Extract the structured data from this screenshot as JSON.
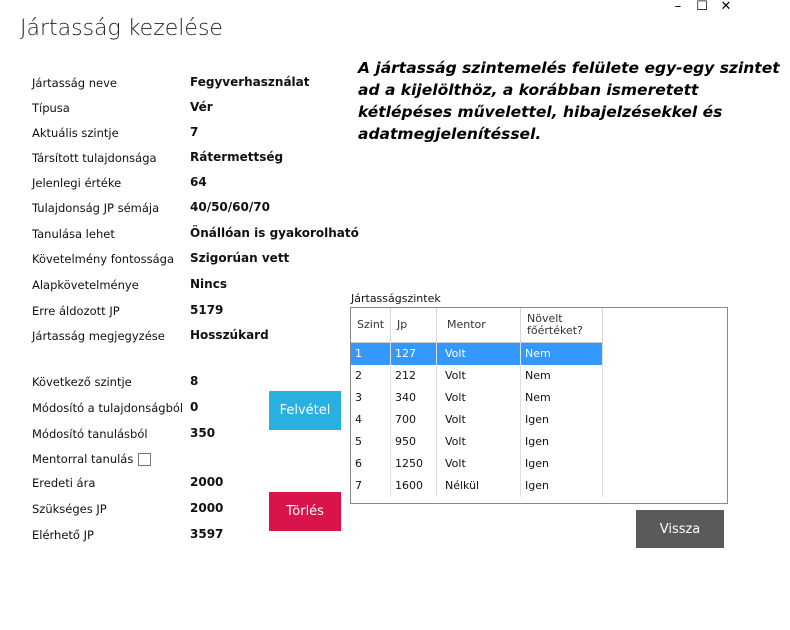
{
  "window": {
    "title": "Jártasság kezelése",
    "controls": {
      "minimize": "–",
      "maximize": "☐",
      "close": "✕"
    }
  },
  "description": "A jártasság szintemelés felülete egy-egy szintet ad a kijelölthöz, a korábban ismeretett kétlépéses művelettel, hibajelzésekkel és adatmegjelenítéssel.",
  "details": [
    {
      "label": "Jártasság neve",
      "value": "Fegyverhasználat"
    },
    {
      "label": "Típusa",
      "value": "Vér"
    },
    {
      "label": "Aktuális szintje",
      "value": "7"
    },
    {
      "label": "Társított tulajdonsága",
      "value": "Rátermettség"
    },
    {
      "label": "Jelenlegi értéke",
      "value": "64"
    },
    {
      "label": "Tulajdonság JP sémája",
      "value": "40/50/60/70"
    },
    {
      "label": "Tanulása lehet",
      "value": "Önállóan is gyakorolható"
    },
    {
      "label": "Követelmény fontossága",
      "value": "Szigorúan vett"
    },
    {
      "label": "Alapkövetelménye",
      "value": "Nincs"
    },
    {
      "label": "Erre áldozott JP",
      "value": "5179"
    },
    {
      "label": "Jártasság megjegyzése",
      "value": "Hosszúkard"
    }
  ],
  "next_level": {
    "next_level": {
      "label": "Következő szintje",
      "value": "8"
    },
    "attr_mod": {
      "label": "Módosító a tulajdonságból",
      "value": "0"
    },
    "learn_mod": {
      "label": "Módosító tanulásból",
      "value": "350"
    },
    "mentor": {
      "label": "Mentorral tanulás",
      "checked": false
    },
    "orig_price": {
      "label": "Eredeti ára",
      "value": "2000"
    },
    "required_jp": {
      "label": "Szükséges JP",
      "value": "2000"
    },
    "available_jp": {
      "label": "Elérhető JP",
      "value": "3597"
    }
  },
  "buttons": {
    "add": "Felvétel",
    "delete": "Törlés",
    "back": "Vissza"
  },
  "colors": {
    "add_button": "#28b0e0",
    "delete_button": "#d8144a",
    "back_button": "#5a5a5a",
    "selected_row": "#3399ff"
  },
  "levels_grid": {
    "caption": "Jártasságszintek",
    "columns": [
      "Szint",
      "Jp",
      "Mentor",
      "Növelt főértéket?"
    ],
    "rows": [
      {
        "level": "1",
        "jp": "127",
        "mentor": "Volt",
        "raised": "Nem",
        "selected": true
      },
      {
        "level": "2",
        "jp": "212",
        "mentor": "Volt",
        "raised": "Nem"
      },
      {
        "level": "3",
        "jp": "340",
        "mentor": "Volt",
        "raised": "Nem"
      },
      {
        "level": "4",
        "jp": "700",
        "mentor": "Volt",
        "raised": "Igen"
      },
      {
        "level": "5",
        "jp": "950",
        "mentor": "Volt",
        "raised": "Igen"
      },
      {
        "level": "6",
        "jp": "1250",
        "mentor": "Volt",
        "raised": "Igen"
      },
      {
        "level": "7",
        "jp": "1600",
        "mentor": "Nélkül",
        "raised": "Igen"
      }
    ]
  }
}
